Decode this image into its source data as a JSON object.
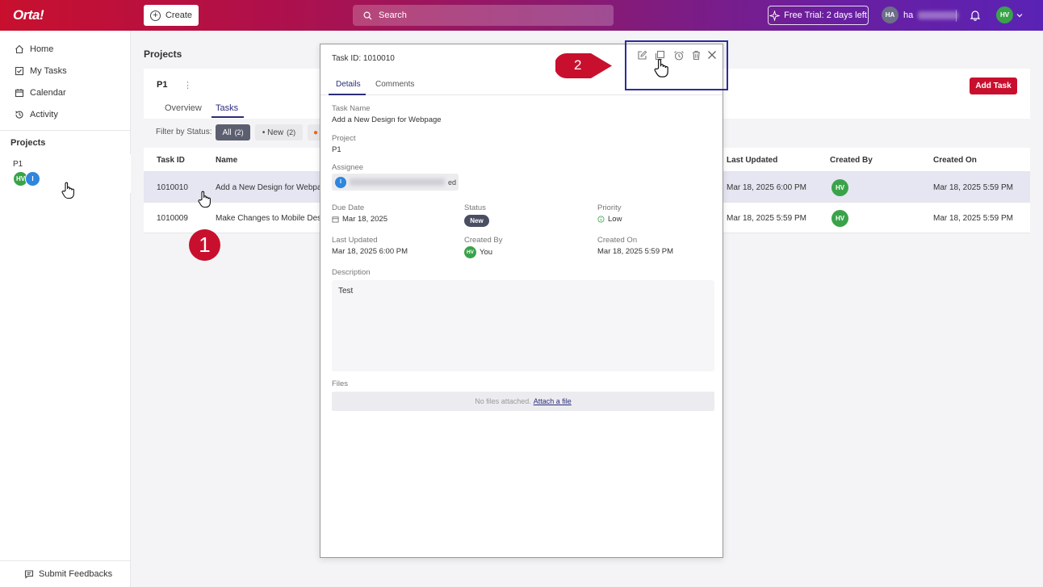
{
  "topbar": {
    "logo": "Orta!",
    "create_label": "Create",
    "search_placeholder": "Search",
    "trial_label": "Free Trial: 2 days left",
    "user_initials": "HA",
    "user_name_visible": "ha",
    "avatar_initials": "HV"
  },
  "sidebar": {
    "items": [
      {
        "label": "Home",
        "icon": "home-icon"
      },
      {
        "label": "My Tasks",
        "icon": "checkbox-icon"
      },
      {
        "label": "Calendar",
        "icon": "calendar-icon"
      },
      {
        "label": "Activity",
        "icon": "history-icon"
      }
    ],
    "projects_heading": "Projects",
    "project_name": "P1",
    "project_members": [
      "HV",
      "I"
    ],
    "feedback_label": "Submit Feedbacks"
  },
  "main": {
    "page_title": "Projects",
    "project_name": "P1",
    "kebab": "⋮",
    "tabs": [
      "Overview",
      "Tasks"
    ],
    "add_task_label": "Add Task",
    "filter_label": "Filter by Status:",
    "filter_chips": [
      {
        "label": "All",
        "count": "(2)"
      },
      {
        "label": "• New",
        "count": "(2)"
      }
    ],
    "columns": [
      "Task ID",
      "Name",
      "Last Updated",
      "Created By",
      "Created On"
    ],
    "rows": [
      {
        "id": "1010010",
        "name": "Add a New Design for Webpa",
        "last_updated": "Mar 18, 2025 6:00 PM",
        "created_by": "HV",
        "created_on": "Mar 18, 2025 5:59 PM"
      },
      {
        "id": "1010009",
        "name": "Make Changes to Mobile Desi",
        "last_updated": "Mar 18, 2025 5:59 PM",
        "created_by": "HV",
        "created_on": "Mar 18, 2025 5:59 PM"
      }
    ]
  },
  "steps": {
    "one": "1",
    "two": "2"
  },
  "panel": {
    "task_id_label": "Task ID:",
    "task_id": "1010010",
    "tabs": [
      "Details",
      "Comments"
    ],
    "task_name_label": "Task Name",
    "task_name": "Add a New Design for Webpage",
    "project_label": "Project",
    "project": "P1",
    "assignee_label": "Assignee",
    "assignee_initial": "I",
    "assignee_suffix": "ed",
    "due_date_label": "Due Date",
    "due_date": "Mar 18, 2025",
    "status_label": "Status",
    "status": "New",
    "priority_label": "Priority",
    "priority": "Low",
    "last_updated_label": "Last Updated",
    "last_updated": "Mar 18, 2025 6:00 PM",
    "created_by_label": "Created By",
    "created_by_initials": "HV",
    "created_by": "You",
    "created_on_label": "Created On",
    "created_on": "Mar 18, 2025 5:59 PM",
    "description_label": "Description",
    "description": "Test",
    "files_label": "Files",
    "no_files": "No files attached.",
    "attach_link": "Attach a file"
  },
  "colors": {
    "brand_red": "#c8102e",
    "brand_purple": "#5a22b5",
    "accent_navy": "#2b2d7a",
    "avatar_green": "#3aa34a",
    "avatar_blue": "#2e86de"
  }
}
